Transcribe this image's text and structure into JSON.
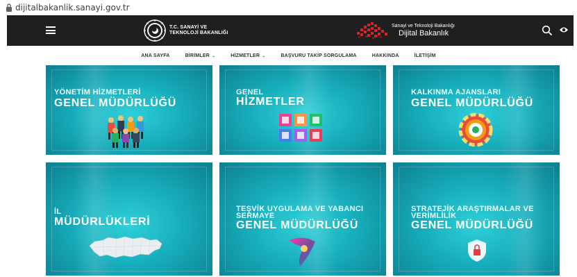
{
  "browser": {
    "url": "dijitalbakanlik.sanayi.gov.tr"
  },
  "header": {
    "logo_left_line1": "T.C. SANAYİ VE",
    "logo_left_line2": "TEKNOLOJİ BAKANLIĞI",
    "logo_right_small": "Sanayi ve Teknoloji Bakanlığı",
    "logo_right_big": "Dijital Bakanlık"
  },
  "nav": {
    "items": [
      {
        "label": "ANA SAYFA",
        "has_dropdown": false
      },
      {
        "label": "BİRİMLER",
        "has_dropdown": true
      },
      {
        "label": "HİZMETLER",
        "has_dropdown": true
      },
      {
        "label": "BAŞVURU TAKİP SORGULAMA",
        "has_dropdown": false
      },
      {
        "label": "HAKKINDA",
        "has_dropdown": false
      },
      {
        "label": "İLETİŞİM",
        "has_dropdown": false
      }
    ],
    "chevron": "⌄"
  },
  "tiles": [
    {
      "line1": "YÖNETİM HİZMETLERİ",
      "line2": "GENEL MÜDÜRLÜĞÜ",
      "icon": "people-group-icon"
    },
    {
      "line1": "GENEL",
      "line2": "HİZMETLER",
      "icon": "document-grid-icon"
    },
    {
      "line1": "KALKINMA AJANSLARI",
      "line2": "GENEL MÜDÜRLÜĞÜ",
      "icon": "radial-chart-icon"
    },
    {
      "line1": "İL",
      "line2": "MÜDÜRLÜKLERİ",
      "icon": "turkey-map-icon"
    },
    {
      "line1": "TEŞVİK UYGULAMA VE YABANCI",
      "line1b": "SERMAYE",
      "line2": "GENEL MÜDÜRLÜĞÜ",
      "icon": "gradient-logo-icon"
    },
    {
      "line1": "STRATEJİK ARAŞTIRMALAR VE",
      "line1b": "VERİMLİLİK",
      "line2": "GENEL MÜDÜRLÜĞÜ",
      "icon": "security-lock-icon"
    }
  ],
  "colors": {
    "header_bg": "#1f1f1f",
    "tile_accent": "#17aebc"
  }
}
